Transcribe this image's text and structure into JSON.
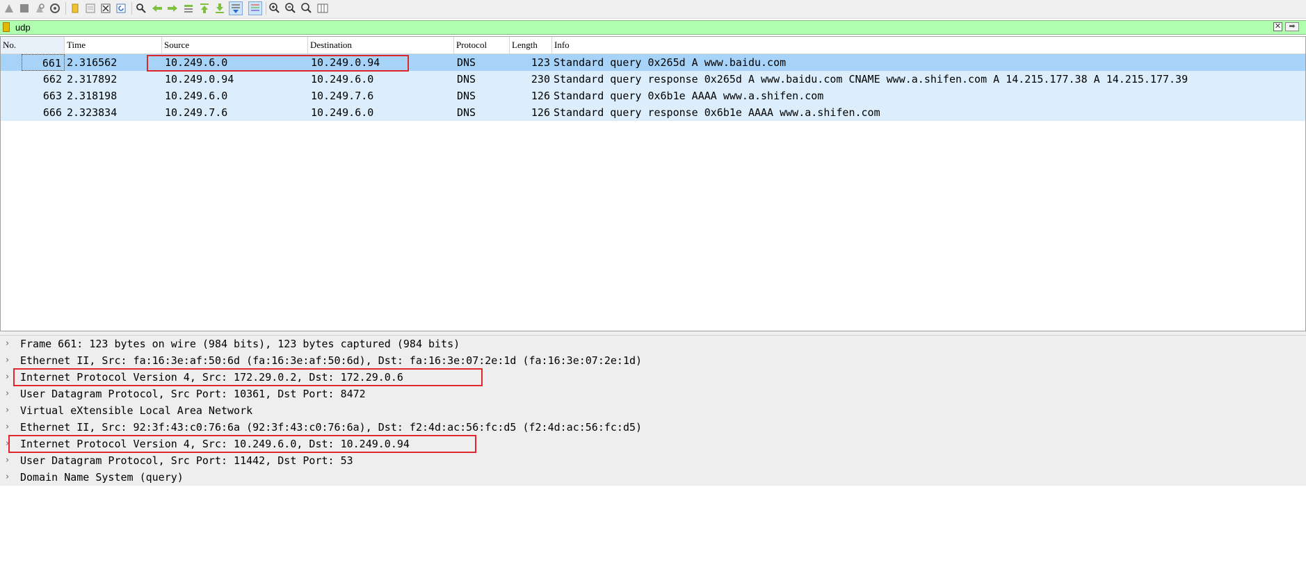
{
  "toolbar": {
    "icons": [
      "start-capture-icon",
      "stop-capture-icon",
      "restart-capture-icon",
      "capture-options-icon",
      "open-file-icon",
      "save-file-icon",
      "close-file-icon",
      "reload-icon",
      "find-packet-icon",
      "go-back-icon",
      "go-forward-icon",
      "go-to-packet-icon",
      "first-packet-icon",
      "last-packet-icon",
      "auto-scroll-icon",
      "colorize-icon",
      "zoom-in-icon",
      "zoom-out-icon",
      "normal-size-icon",
      "resize-columns-icon"
    ]
  },
  "filter": {
    "value": "udp",
    "clear_label": "✕",
    "apply_label": "➡"
  },
  "packet_list": {
    "columns": [
      "No.",
      "Time",
      "Source",
      "Destination",
      "Protocol",
      "Length",
      "Info"
    ],
    "rows": [
      {
        "no": "661",
        "time": "2.316562",
        "source": "10.249.6.0",
        "destination": "10.249.0.94",
        "protocol": "DNS",
        "length": "123",
        "info": "Standard query 0x265d A www.baidu.com",
        "selected": true
      },
      {
        "no": "662",
        "time": "2.317892",
        "source": "10.249.0.94",
        "destination": "10.249.6.0",
        "protocol": "DNS",
        "length": "230",
        "info": "Standard query response 0x265d A www.baidu.com CNAME www.a.shifen.com A 14.215.177.38 A 14.215.177.39",
        "selected": false
      },
      {
        "no": "663",
        "time": "2.318198",
        "source": "10.249.6.0",
        "destination": "10.249.7.6",
        "protocol": "DNS",
        "length": "126",
        "info": "Standard query 0x6b1e AAAA www.a.shifen.com",
        "selected": false
      },
      {
        "no": "666",
        "time": "2.323834",
        "source": "10.249.7.6",
        "destination": "10.249.6.0",
        "protocol": "DNS",
        "length": "126",
        "info": "Standard query response 0x6b1e AAAA www.a.shifen.com",
        "selected": false
      }
    ]
  },
  "details": [
    "Frame 661: 123 bytes on wire (984 bits), 123 bytes captured (984 bits)",
    "Ethernet II, Src: fa:16:3e:af:50:6d (fa:16:3e:af:50:6d), Dst: fa:16:3e:07:2e:1d (fa:16:3e:07:2e:1d)",
    "Internet Protocol Version 4, Src: 172.29.0.2, Dst: 172.29.0.6",
    "User Datagram Protocol, Src Port: 10361, Dst Port: 8472",
    "Virtual eXtensible Local Area Network",
    "Ethernet II, Src: 92:3f:43:c0:76:6a (92:3f:43:c0:76:6a), Dst: f2:4d:ac:56:fc:d5 (f2:4d:ac:56:fc:d5)",
    "Internet Protocol Version 4, Src: 10.249.6.0, Dst: 10.249.0.94",
    "User Datagram Protocol, Src Port: 11442, Dst Port: 53",
    "Domain Name System (query)"
  ],
  "details_chevron": "›",
  "colors": {
    "filter_valid_bg": "#afffaf",
    "selected_row_bg": "#a8d3f8",
    "row_bg": "#dcedfc",
    "highlight_box": "#e0252b"
  }
}
